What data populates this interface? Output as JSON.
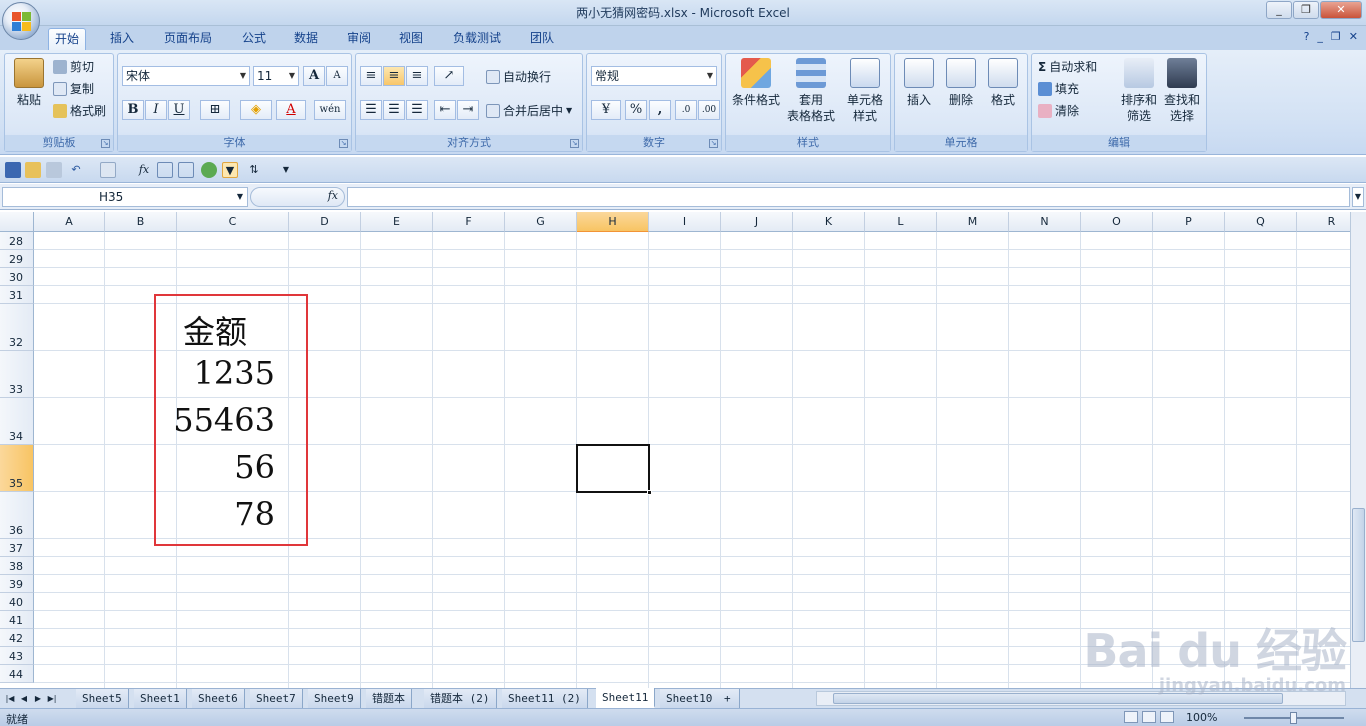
{
  "window": {
    "title": "两小无猜网密码.xlsx - Microsoft Excel",
    "minimize": "_",
    "restore": "❐",
    "close": "✕"
  },
  "tabs": [
    "开始",
    "插入",
    "页面布局",
    "公式",
    "数据",
    "审阅",
    "视图",
    "负载测试",
    "团队"
  ],
  "tabs_right": [
    "?",
    "_",
    "❐",
    "✕"
  ],
  "ribbon": {
    "clipboard": {
      "label": "剪贴板",
      "paste": "粘贴",
      "cut": "剪切",
      "copy": "复制",
      "format_painter": "格式刷"
    },
    "font": {
      "label": "字体",
      "name": "宋体",
      "size": "11",
      "bold": "B",
      "italic": "I",
      "underline": "U",
      "grow": "A",
      "shrink": "A",
      "phonetic": "wén"
    },
    "alignment": {
      "label": "对齐方式",
      "wrap": "自动换行",
      "merge": "合并后居中"
    },
    "number": {
      "label": "数字",
      "format": "常规",
      "percent": "%",
      "comma": ","
    },
    "styles": {
      "label": "样式",
      "conditional": "条件格式",
      "table1": "套用",
      "table2": "表格格式",
      "cell1": "单元格",
      "cell2": "样式"
    },
    "cells": {
      "label": "单元格",
      "insert": "插入",
      "delete": "删除",
      "format": "格式"
    },
    "editing": {
      "label": "编辑",
      "autosum": "自动求和",
      "fill": "填充",
      "clear": "清除",
      "sort1": "排序和",
      "sort2": "筛选",
      "find1": "查找和",
      "find2": "选择"
    }
  },
  "formula_bar": {
    "name_box": "H35",
    "fx": "fx",
    "value": ""
  },
  "columns": [
    "A",
    "B",
    "C",
    "D",
    "E",
    "F",
    "G",
    "H",
    "I",
    "J",
    "K",
    "L",
    "M",
    "N",
    "O",
    "P",
    "Q",
    "R"
  ],
  "selected_column": "H",
  "rows": [
    "28",
    "29",
    "30",
    "31",
    "32",
    "33",
    "34",
    "35",
    "36",
    "37",
    "38",
    "39",
    "40",
    "41",
    "42",
    "43",
    "44"
  ],
  "selected_row": "35",
  "cells": {
    "C32": "金额",
    "C33": "1235",
    "C34": "55463",
    "C35": "56",
    "C36": "78"
  },
  "sheets": [
    "Sheet5",
    "Sheet1",
    "Sheet6",
    "Sheet7",
    "Sheet9",
    "错题本",
    "错题本 (2)",
    "Sheet11 (2)",
    "Sheet11",
    "Sheet10"
  ],
  "active_sheet": "Sheet11",
  "status": {
    "ready": "就绪",
    "zoom": "100%"
  },
  "watermark": {
    "brand": "Bai du 经验",
    "url": "jingyan.baidu.com"
  },
  "colors": {
    "accent": "#15428b",
    "highlight_box": "#e0363a",
    "selected_header": "#f8c463"
  }
}
